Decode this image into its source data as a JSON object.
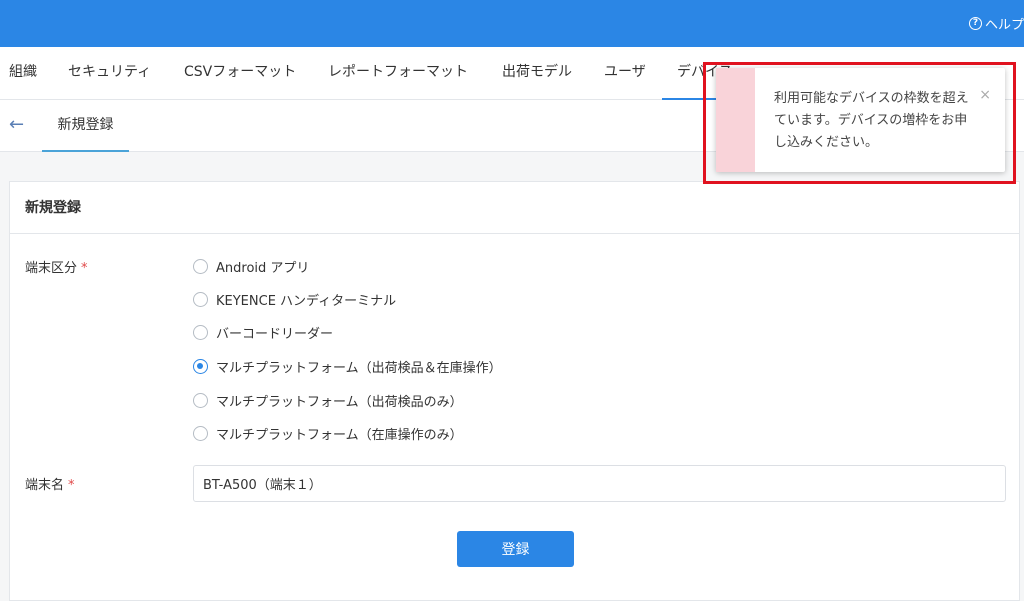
{
  "header": {
    "help_label": "ヘルプ",
    "help_icon": "question-circle-icon"
  },
  "tabs": [
    {
      "label": "組織"
    },
    {
      "label": "セキュリティ"
    },
    {
      "label": "CSVフォーマット"
    },
    {
      "label": "レポートフォーマット"
    },
    {
      "label": "出荷モデル"
    },
    {
      "label": "ユーザ"
    },
    {
      "label": "デバイス",
      "active": true
    }
  ],
  "subnav": {
    "back_icon": "arrow-left-icon",
    "active_tab": "新規登録"
  },
  "form": {
    "title": "新規登録",
    "terminal_type_label": "端末区分",
    "required_mark": "*",
    "options": [
      {
        "label": "Android アプリ",
        "checked": false
      },
      {
        "label": "KEYENCE ハンディターミナル",
        "checked": false
      },
      {
        "label": "バーコードリーダー",
        "checked": false
      },
      {
        "label": "マルチプラットフォーム（出荷検品＆在庫操作）",
        "checked": true
      },
      {
        "label": "マルチプラットフォーム（出荷検品のみ）",
        "checked": false
      },
      {
        "label": "マルチプラットフォーム（在庫操作のみ）",
        "checked": false
      }
    ],
    "terminal_name_label": "端末名",
    "terminal_name_value": "BT-A500（端末１）",
    "submit_label": "登録"
  },
  "toast": {
    "message": "利用可能なデバイスの枠数を超えています。デバイスの増枠をお申し込みください。",
    "close_symbol": "×",
    "accent_color": "#f9d3d9",
    "highlight_color": "#e0121f"
  },
  "colors": {
    "primary": "#2b86e5"
  }
}
